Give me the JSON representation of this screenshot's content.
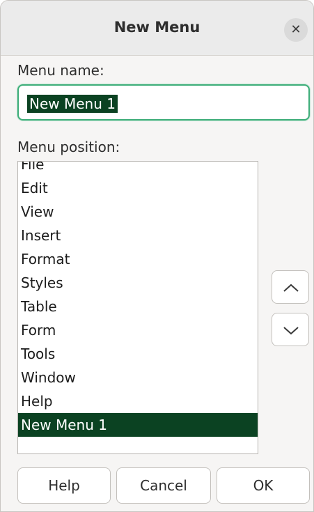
{
  "dialog": {
    "title": "New Menu",
    "close_icon": "close-icon"
  },
  "menu_name": {
    "label": "Menu name:",
    "value": "New Menu 1"
  },
  "menu_position": {
    "label": "Menu position:",
    "items": [
      {
        "label": "File",
        "selected": false
      },
      {
        "label": "Edit",
        "selected": false
      },
      {
        "label": "View",
        "selected": false
      },
      {
        "label": "Insert",
        "selected": false
      },
      {
        "label": "Format",
        "selected": false
      },
      {
        "label": "Styles",
        "selected": false
      },
      {
        "label": "Table",
        "selected": false
      },
      {
        "label": "Form",
        "selected": false
      },
      {
        "label": "Tools",
        "selected": false
      },
      {
        "label": "Window",
        "selected": false
      },
      {
        "label": "Help",
        "selected": false
      },
      {
        "label": "New Menu 1",
        "selected": true
      }
    ],
    "move_up_icon": "chevron-up-icon",
    "move_down_icon": "chevron-down-icon"
  },
  "buttons": {
    "help": "Help",
    "cancel": "Cancel",
    "ok": "OK"
  },
  "colors": {
    "selection": "#0b4222",
    "focus_border": "#3fae7a"
  }
}
